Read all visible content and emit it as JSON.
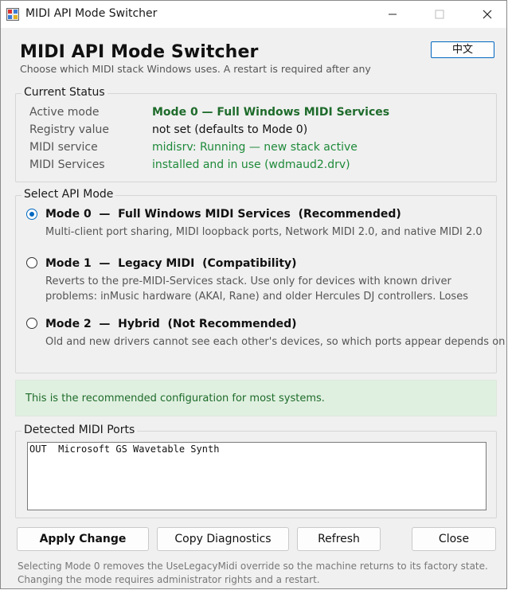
{
  "window": {
    "title": "MIDI API Mode Switcher",
    "minimize_icon": "minimize-icon",
    "maximize_icon": "maximize-icon",
    "close_icon": "close-icon"
  },
  "header": {
    "title": "MIDI API Mode Switcher",
    "subtitle": "Choose which MIDI stack Windows uses. A restart is required after any",
    "language_button": "中文"
  },
  "status": {
    "group_label": "Current Status",
    "rows": [
      {
        "key": "Active mode",
        "value": "Mode 0 — Full Windows MIDI Services"
      },
      {
        "key": "Registry value",
        "value": "not set (defaults to Mode 0)"
      },
      {
        "key": "MIDI service",
        "value": "midisrv: Running — new stack active"
      },
      {
        "key": "MIDI Services",
        "value": "installed and in use (wdmaud2.drv)"
      }
    ],
    "colors": {
      "active_mode": "#1e6b2b",
      "service": "#1e8a3a",
      "default": "#111111"
    }
  },
  "modes": {
    "group_label": "Select API Mode",
    "selected": 0,
    "items": [
      {
        "title": "Mode 0  —  Full Windows MIDI Services  (Recommended)",
        "desc": [
          "Multi-client port sharing, MIDI loopback ports, Network MIDI 2.0, and native MIDI 2.0"
        ]
      },
      {
        "title": "Mode 1  —  Legacy MIDI  (Compatibility)",
        "desc": [
          "Reverts to the pre-MIDI-Services stack. Use only for devices with known driver",
          "problems: inMusic hardware (AKAI, Rane) and older Hercules DJ controllers. Loses"
        ]
      },
      {
        "title": "Mode 2  —  Hybrid  (Not Recommended)",
        "desc": [
          "Old and new drivers cannot see each other's devices, so which ports appear depends on"
        ]
      }
    ]
  },
  "info": {
    "message": "This is the recommended configuration for most systems.",
    "background": "#dff0e0"
  },
  "ports": {
    "group_label": "Detected MIDI Ports",
    "lines": [
      "OUT  Microsoft GS Wavetable Synth"
    ]
  },
  "buttons": {
    "apply": "Apply Change",
    "copy": "Copy Diagnostics",
    "refresh": "Refresh",
    "close": "Close"
  },
  "footer": {
    "lines": [
      "Selecting Mode 0 removes the UseLegacyMidi override so the machine returns to its factory state.",
      "Changing the mode requires administrator rights and a restart."
    ]
  },
  "accent": "#0067c0"
}
